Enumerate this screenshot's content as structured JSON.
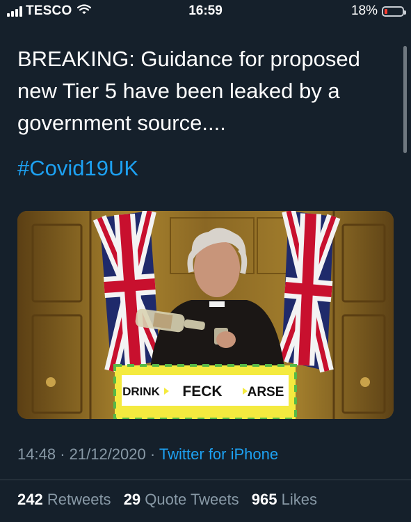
{
  "status_bar": {
    "carrier": "TESCO",
    "time": "16:59",
    "battery_percent": "18%",
    "battery_level": 0.18,
    "icons": [
      "cellular-signal-icon",
      "wifi-icon",
      "battery-icon"
    ]
  },
  "tweet": {
    "text": "BREAKING: Guidance for proposed new Tier 5 have been leaked by a government source....",
    "hashtag": "#Covid19UK",
    "media": {
      "sign_words": [
        "DRINK",
        "FECK",
        "ARSE"
      ]
    },
    "timestamp_time": "14:48",
    "timestamp_sep": "·",
    "timestamp_date": "21/12/2020",
    "source_sep": "·",
    "source": "Twitter for iPhone",
    "retweets_count": "242",
    "retweets_label": "Retweets",
    "quote_count": "29",
    "quote_label": "Quote Tweets",
    "likes_count": "965",
    "likes_label": "Likes"
  },
  "colors": {
    "background": "#15202b",
    "link": "#1da1f2",
    "secondary_text": "#8899a6",
    "battery_low": "#ff3b30"
  }
}
